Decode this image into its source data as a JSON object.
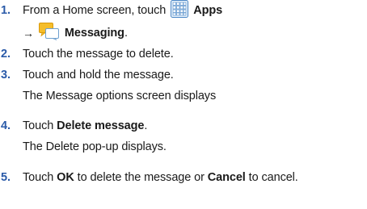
{
  "steps": [
    {
      "number": "1.",
      "line1": {
        "prefix": "From a Home screen, touch",
        "apps_label": "Apps"
      },
      "line2": {
        "arrow": "→",
        "messaging_label": "Messaging",
        "suffix": "."
      }
    },
    {
      "number": "2.",
      "text": "Touch the message to delete."
    },
    {
      "number": "3.",
      "text": "Touch and hold the message.",
      "note": "The Message options screen displays"
    },
    {
      "number": "4.",
      "prefix": "Touch",
      "bold": "Delete message",
      "suffix": ".",
      "note": "The Delete pop-up displays."
    },
    {
      "number": "5.",
      "prefix": "Touch",
      "ok": "OK",
      "middle": "to delete the message or",
      "cancel": "Cancel",
      "suffix": "to cancel."
    }
  ],
  "icons": {
    "apps": "apps-grid-icon",
    "messaging": "messaging-icon"
  },
  "colors": {
    "step_number": "#2a5aa8",
    "apps_icon_border": "#4a86c5",
    "messaging_bubble": "#f2b21b"
  }
}
